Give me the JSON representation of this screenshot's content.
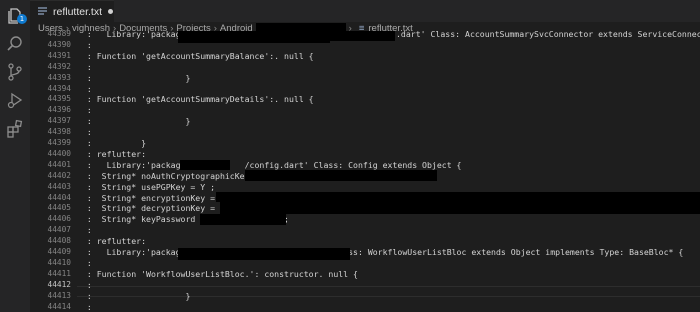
{
  "tab": {
    "label": "reflutter.txt"
  },
  "breadcrumb": {
    "parts": [
      "Users",
      "vighnesh",
      "Documents",
      "Projects",
      "Android"
    ],
    "file": "reflutter.txt"
  },
  "activity_badge": "1",
  "lines": [
    {
      "num": "44389",
      "text": "  :   Library:'package:"
    },
    {
      "num": "44390",
      "text": "  :"
    },
    {
      "num": "44391",
      "text": "  : Function 'getAccountSummaryBalance':. null {"
    },
    {
      "num": "44392",
      "text": "  :"
    },
    {
      "num": "44393",
      "text": "  :                   }"
    },
    {
      "num": "44394",
      "text": "  :"
    },
    {
      "num": "44395",
      "text": "  : Function 'getAccountSummaryDetails':. null {"
    },
    {
      "num": "44396",
      "text": "  :"
    },
    {
      "num": "44397",
      "text": "  :                   }"
    },
    {
      "num": "44398",
      "text": "  :"
    },
    {
      "num": "44399",
      "text": "  :          }"
    },
    {
      "num": "44400",
      "text": "  : reflutter:"
    },
    {
      "num": "44401",
      "text": "  :   Library:'package:           /config.dart' Class: Config extends Object {"
    },
    {
      "num": "44402",
      "text": "  :  String* noAuthCryptographicKey =                                ;"
    },
    {
      "num": "44403",
      "text": "  :  String* usePGPKey = Y ;"
    },
    {
      "num": "44404",
      "text": "  :  String* encryptionKey = LS"
    },
    {
      "num": "44405",
      "text": "  :  String* decryptionKey = \"L"
    },
    {
      "num": "44406",
      "text": "  :  String* keyPassword = \"             \";"
    },
    {
      "num": "44407",
      "text": "  :"
    },
    {
      "num": "44408",
      "text": "  : reflutter:"
    },
    {
      "num": "44409",
      "text": "  :   Library:'package:                      .dart' Class: WorkflowUserListBloc extends Object implements Type: BaseBloc* {"
    },
    {
      "num": "44410",
      "text": "  :"
    },
    {
      "num": "44411",
      "text": "  : Function 'WorkflowUserListBloc.': constructor. null {"
    },
    {
      "num": "44412",
      "text": "  :"
    },
    {
      "num": "44413",
      "text": "  :                   }"
    },
    {
      "num": "44414",
      "text": "  :"
    }
  ],
  "line_44389_tail": ".dart' Class: AccountSummarySvcConnector extends ServiceConnector {",
  "colors": {
    "editor_bg": "#1e1e1e",
    "activity_bg": "#252526",
    "text": "#d4d4d4",
    "line_number": "#858585",
    "badge": "#0e7ad0"
  },
  "icons": [
    "explorer-icon",
    "search-icon",
    "source-control-icon",
    "run-debug-icon",
    "extensions-icon",
    "file-icon"
  ]
}
